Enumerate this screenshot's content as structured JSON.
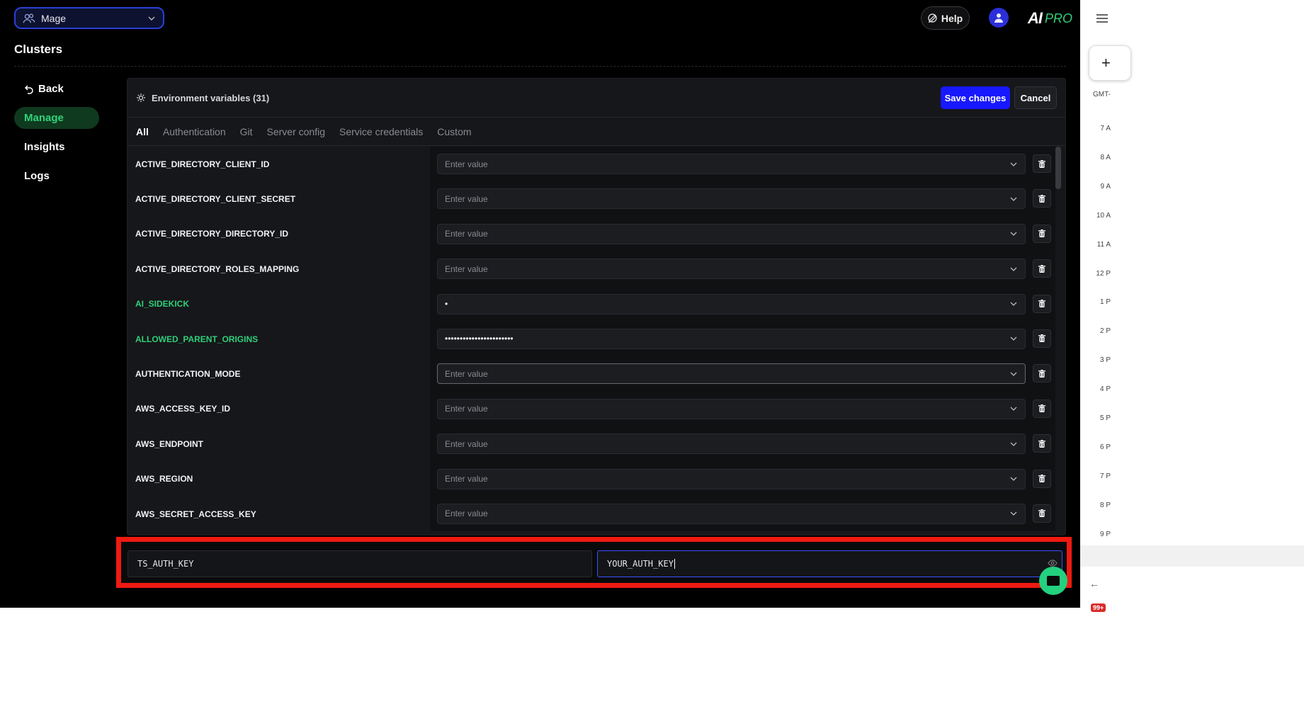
{
  "topbar": {
    "workspace": "Mage",
    "help_label": "Help",
    "logo_text": "AI",
    "logo_pro": "PRO"
  },
  "page": {
    "title": "Clusters"
  },
  "sidebar": {
    "items": [
      {
        "label": "Back"
      },
      {
        "label": "Manage"
      },
      {
        "label": "Insights"
      },
      {
        "label": "Logs"
      }
    ]
  },
  "panel": {
    "title": "Environment variables (31)",
    "save_label": "Save changes",
    "cancel_label": "Cancel",
    "tabs": [
      "All",
      "Authentication",
      "Git",
      "Server config",
      "Service credentials",
      "Custom"
    ]
  },
  "rows": [
    {
      "key": "ACTIVE_DIRECTORY_CLIENT_ID",
      "value": "Enter value"
    },
    {
      "key": "ACTIVE_DIRECTORY_CLIENT_SECRET",
      "value": "Enter value"
    },
    {
      "key": "ACTIVE_DIRECTORY_DIRECTORY_ID",
      "value": "Enter value"
    },
    {
      "key": "ACTIVE_DIRECTORY_ROLES_MAPPING",
      "value": "Enter value"
    },
    {
      "key": "AI_SIDEKICK",
      "value": "•"
    },
    {
      "key": "ALLOWED_PARENT_ORIGINS",
      "value": "•••••••••••••••••••••••"
    },
    {
      "key": "AUTHENTICATION_MODE",
      "value": "Enter value"
    },
    {
      "key": "AWS_ACCESS_KEY_ID",
      "value": "Enter value"
    },
    {
      "key": "AWS_ENDPOINT",
      "value": "Enter value"
    },
    {
      "key": "AWS_REGION",
      "value": "Enter value"
    },
    {
      "key": "AWS_SECRET_ACCESS_KEY",
      "value": "Enter value"
    }
  ],
  "new_var": {
    "key": "TS_AUTH_KEY",
    "value": "YOUR_AUTH_KEY"
  },
  "calendar": {
    "plus": "+",
    "timezone": "GMT-",
    "hours": [
      "7 A",
      "8 A",
      "9 A",
      "10 A",
      "11 A",
      "12 P",
      "1 P",
      "2 P",
      "3 P",
      "4 P",
      "5 P",
      "6 P",
      "7 P",
      "8 P",
      "9 P"
    ],
    "badge": "99+"
  },
  "colors": {
    "accent_blue": "#1818ff",
    "green": "#2fcf7a",
    "highlight_red": "#ee1a12"
  }
}
